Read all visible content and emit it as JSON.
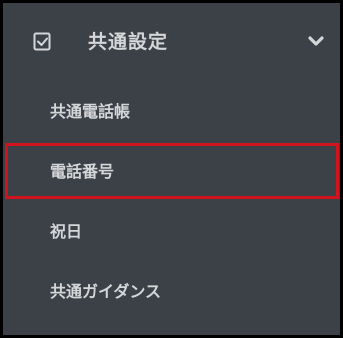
{
  "menu": {
    "group": {
      "label": "共通設定",
      "icon": "checkbox-square-icon",
      "expand_icon": "chevron-down-icon",
      "expanded": true
    },
    "items": [
      {
        "label": "共通電話帳"
      },
      {
        "label": "電話番号",
        "highlighted": true
      },
      {
        "label": "祝日"
      },
      {
        "label": "共通ガイダンス"
      }
    ]
  },
  "colors": {
    "background": "#3c4148",
    "text": "#d4d6d8",
    "highlight_border": "#d0141e",
    "outer_border": "#000000"
  }
}
